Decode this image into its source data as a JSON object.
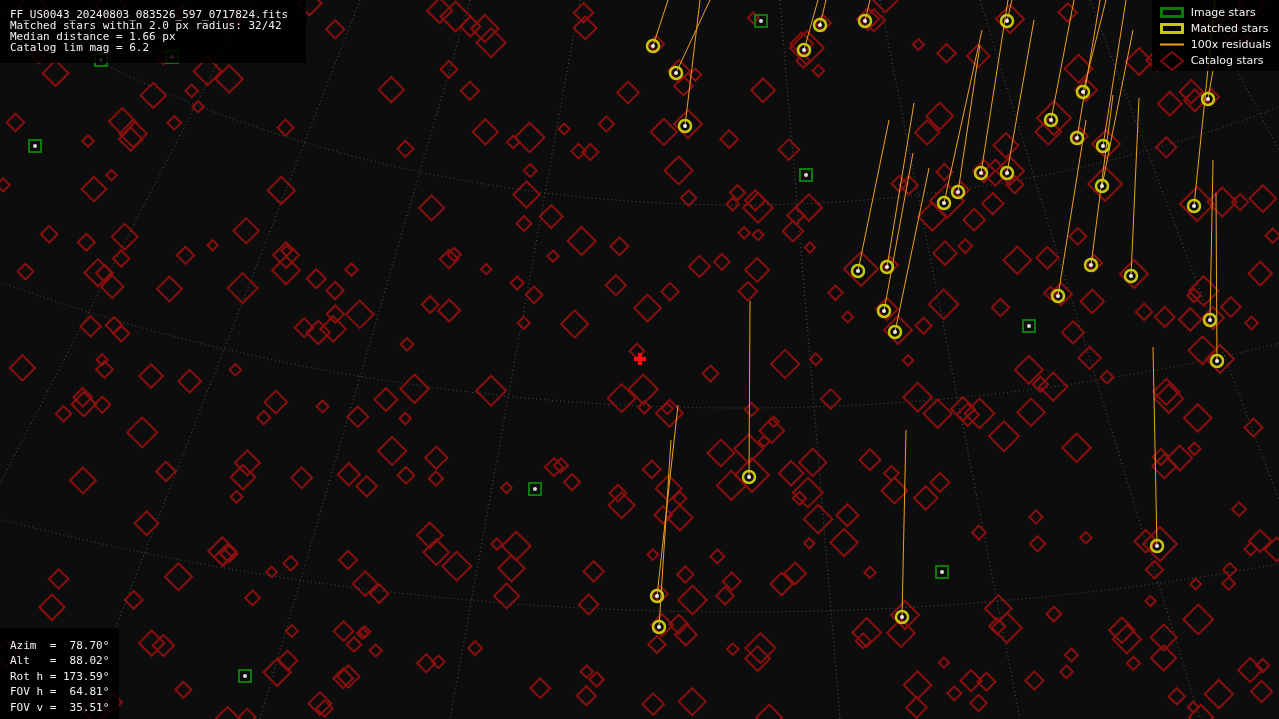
{
  "file_info": [
    "FF_US0043_20240803_083526_597_0717824.fits",
    "Matched stars within 2.0 px radius: 32/42",
    "Median distance = 1.66 px",
    "Catalog lim mag = 6.2"
  ],
  "pointing": [
    "Azim  =  78.70°",
    "Alt   =  88.02°",
    "Rot h = 173.59°",
    "FOV h =  64.81°",
    "FOV v =  35.51°"
  ],
  "legend": [
    {
      "kind": "image",
      "label": "Image stars"
    },
    {
      "kind": "matched",
      "label": "Matched stars"
    },
    {
      "kind": "residual",
      "label": "100x residuals"
    },
    {
      "kind": "catalog",
      "label": "Catalog stars"
    }
  ]
}
